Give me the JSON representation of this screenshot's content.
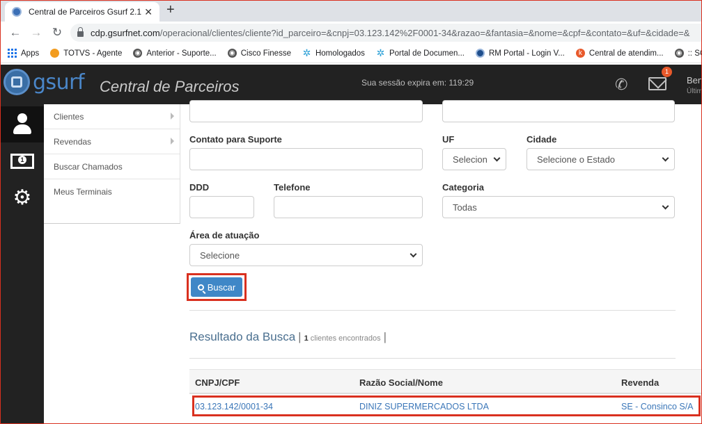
{
  "browser": {
    "tab_title": "Central de Parceiros Gsurf 2.1",
    "tab_close": "✕",
    "new_tab": "+",
    "url_host": "cdp.gsurfnet.com",
    "url_path": "/operacional/clientes/cliente?id_parceiro=&cnpj=03.123.142%2F0001-34&razao=&fantasia=&nome=&cpf=&contato=&uf=&cidade=&",
    "bookmarks": [
      {
        "label": "Apps",
        "icon": "apps-grid-icon"
      },
      {
        "label": "TOTVS - Agente",
        "icon": "totvs-icon",
        "color": "#f29c1f"
      },
      {
        "label": "Anterior - Suporte...",
        "icon": "globe-icon",
        "color": "#555555"
      },
      {
        "label": "Cisco Finesse",
        "icon": "globe-icon",
        "color": "#555555"
      },
      {
        "label": "Homologados",
        "icon": "star-burst-icon",
        "color": "#2a9fd6"
      },
      {
        "label": "Portal de Documen...",
        "icon": "star-burst-icon",
        "color": "#2a9fd6"
      },
      {
        "label": "RM Portal - Login V...",
        "icon": "rm-portal-icon",
        "color": "#1f4e8c"
      },
      {
        "label": "Central de atendim...",
        "icon": "k-icon",
        "color": "#e8592b"
      },
      {
        "label": ":: SOF",
        "icon": "globe-icon",
        "color": "#555555"
      }
    ]
  },
  "header": {
    "logo_text": "gsurf",
    "app_title": "Central de Parceiros",
    "session_text": "Sua sessão expira em: 119:29",
    "notification_count": "1",
    "user_name": "Ben",
    "user_sub": "Últim"
  },
  "sidebar": {
    "items": [
      {
        "label": "Clientes",
        "has_arrow": true
      },
      {
        "label": "Revendas",
        "has_arrow": true
      },
      {
        "label": "Buscar Chamados",
        "has_arrow": false
      },
      {
        "label": "Meus Terminais",
        "has_arrow": false
      }
    ]
  },
  "form": {
    "contato_label": "Contato para Suporte",
    "uf_label": "UF",
    "uf_value": "Selecion",
    "cidade_label": "Cidade",
    "cidade_value": "Selecione o Estado",
    "ddd_label": "DDD",
    "telefone_label": "Telefone",
    "categoria_label": "Categoria",
    "categoria_value": "Todas",
    "area_label": "Área de atuação",
    "area_value": "Selecione",
    "buscar_label": "Buscar"
  },
  "results": {
    "title": "Resultado da Busca",
    "sep": "|",
    "count": "1",
    "count_suffix": "clientes encontrados",
    "columns": [
      "CNPJ/CPF",
      "Razão Social/Nome",
      "Revenda"
    ],
    "rows": [
      {
        "cnpj": "03.123.142/0001-34",
        "razao": "DINIZ SUPERMERCADOS LTDA",
        "revenda": "SE - Consinco S/A"
      }
    ]
  },
  "colors": {
    "highlight_border": "#d9301f",
    "button_blue": "#3f87c7",
    "header_bg": "#222222"
  }
}
